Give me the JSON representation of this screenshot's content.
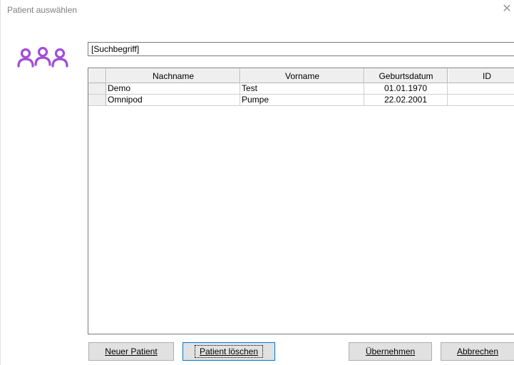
{
  "window": {
    "title": "Patient auswählen",
    "close_glyph": "✕"
  },
  "logo": {
    "icon": "users-group-icon",
    "color": "#a24cd9"
  },
  "search": {
    "value": "[Suchbegriff]"
  },
  "table": {
    "columns": [
      "",
      "Nachname",
      "Vorname",
      "Geburtsdatum",
      "ID"
    ],
    "rows": [
      {
        "nachname": "Demo",
        "vorname": "Test",
        "geburtsdatum": "01.01.1970",
        "id": ""
      },
      {
        "nachname": "Omnipod",
        "vorname": "Pumpe",
        "geburtsdatum": "22.02.2001",
        "id": ""
      }
    ]
  },
  "buttons": {
    "new_patient": "Neuer Patient",
    "delete_patient": "Patient löschen",
    "apply": "Übernehmen",
    "cancel": "Abbrechen"
  }
}
